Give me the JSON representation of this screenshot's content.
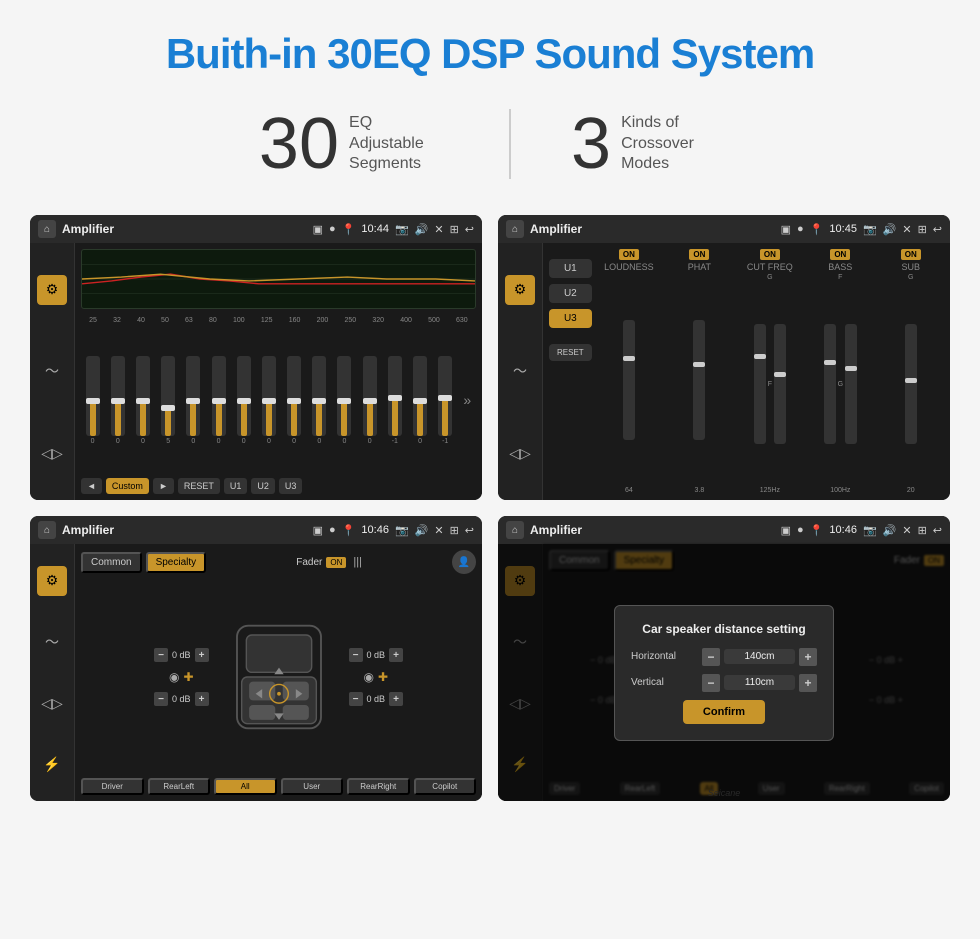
{
  "title": "Buith-in 30EQ DSP Sound System",
  "stats": {
    "eq": {
      "number": "30",
      "label": "EQ Adjustable\nSegments"
    },
    "crossover": {
      "number": "3",
      "label": "Kinds of\nCrossover Modes"
    }
  },
  "screen1": {
    "topbar": {
      "title": "Amplifier",
      "time": "10:44"
    },
    "freq_labels": [
      "25",
      "32",
      "40",
      "50",
      "63",
      "80",
      "100",
      "125",
      "160",
      "200",
      "250",
      "320",
      "400",
      "500",
      "630"
    ],
    "sliders": [
      {
        "value": 0,
        "pos": 50
      },
      {
        "value": 0,
        "pos": 50
      },
      {
        "value": 0,
        "pos": 50
      },
      {
        "value": 5,
        "pos": 42
      },
      {
        "value": 0,
        "pos": 50
      },
      {
        "value": 0,
        "pos": 50
      },
      {
        "value": 0,
        "pos": 50
      },
      {
        "value": 0,
        "pos": 50
      },
      {
        "value": 0,
        "pos": 50
      },
      {
        "value": 0,
        "pos": 50
      },
      {
        "value": 0,
        "pos": 50
      },
      {
        "value": 0,
        "pos": 50
      },
      {
        "value": -1,
        "pos": 53
      },
      {
        "value": 0,
        "pos": 50
      },
      {
        "value": -1,
        "pos": 53
      }
    ],
    "controls": {
      "prev": "◄",
      "label": "Custom",
      "next": "►",
      "reset": "RESET",
      "u1": "U1",
      "u2": "U2",
      "u3": "U3"
    }
  },
  "screen2": {
    "topbar": {
      "title": "Amplifier",
      "time": "10:45"
    },
    "u_buttons": [
      "U1",
      "U2",
      "U3"
    ],
    "active_u": "U3",
    "channels": [
      {
        "name": "LOUDNESS",
        "on": true
      },
      {
        "name": "PHAT",
        "on": true
      },
      {
        "name": "CUT FREQ",
        "on": true
      },
      {
        "name": "BASS",
        "on": true
      },
      {
        "name": "SUB",
        "on": true
      }
    ],
    "reset": "RESET"
  },
  "screen3": {
    "topbar": {
      "title": "Amplifier",
      "time": "10:46"
    },
    "tabs": [
      "Common",
      "Specialty"
    ],
    "active_tab": "Specialty",
    "fader": "Fader",
    "fader_on": "ON",
    "db_values": [
      "0 dB",
      "0 dB",
      "0 dB",
      "0 dB"
    ],
    "seat_buttons": [
      "Driver",
      "RearLeft",
      "All",
      "User",
      "RearRight",
      "Copilot"
    ],
    "active_seat": "All"
  },
  "screen4": {
    "topbar": {
      "title": "Amplifier",
      "time": "10:46"
    },
    "tabs": [
      "Common",
      "Specialty"
    ],
    "dialog": {
      "title": "Car speaker distance setting",
      "horizontal_label": "Horizontal",
      "horizontal_value": "140cm",
      "vertical_label": "Vertical",
      "vertical_value": "110cm",
      "confirm_label": "Confirm"
    },
    "seat_buttons": [
      "Driver",
      "RearLeft",
      "All",
      "User",
      "RearRight",
      "Copilot"
    ]
  },
  "watermark": "Seicane"
}
